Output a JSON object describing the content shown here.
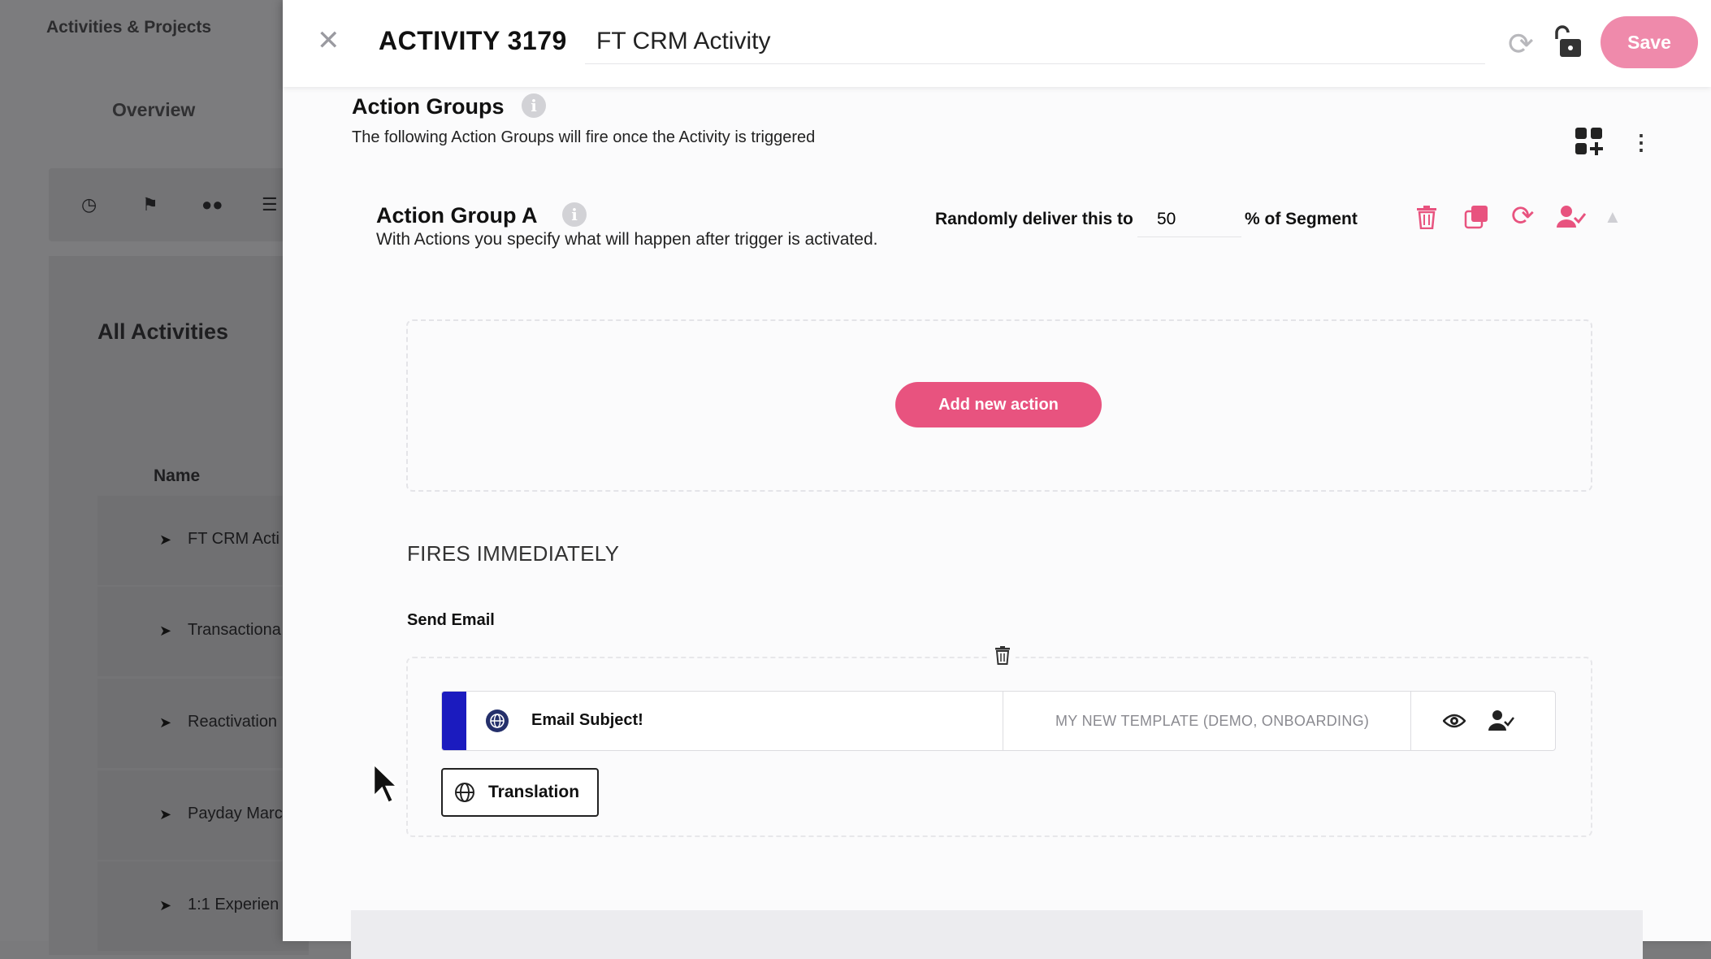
{
  "background": {
    "app_title": "Activities & Projects",
    "tab_overview": "Overview",
    "section_title": "All Activities",
    "column_name": "Name",
    "rows": [
      "FT CRM Acti",
      "Transactiona",
      "Reactivation",
      "Payday Marc",
      "1:1 Experien"
    ]
  },
  "header": {
    "activity_label": "ACTIVITY 3179",
    "activity_name": "FT CRM Activity",
    "save_label": "Save"
  },
  "action_groups": {
    "title": "Action Groups",
    "description": "The following Action Groups will fire once the Activity is triggered"
  },
  "group": {
    "title": "Action Group A",
    "description": "With Actions you specify what will happen after trigger is activated.",
    "random_label": "Randomly deliver this to",
    "random_value": "50",
    "segment_label": "% of Segment",
    "add_action_label": "Add new action"
  },
  "timing": {
    "label": "FIRES IMMEDIATELY"
  },
  "send_email": {
    "label": "Send Email",
    "subject": "Email Subject!",
    "template": "MY NEW TEMPLATE (DEMO, ONBOARDING)",
    "translation_label": "Translation"
  },
  "colors": {
    "accent": "#e8537f",
    "save_disabled": "#ef8aab",
    "stripe": "#1b1bbf"
  }
}
